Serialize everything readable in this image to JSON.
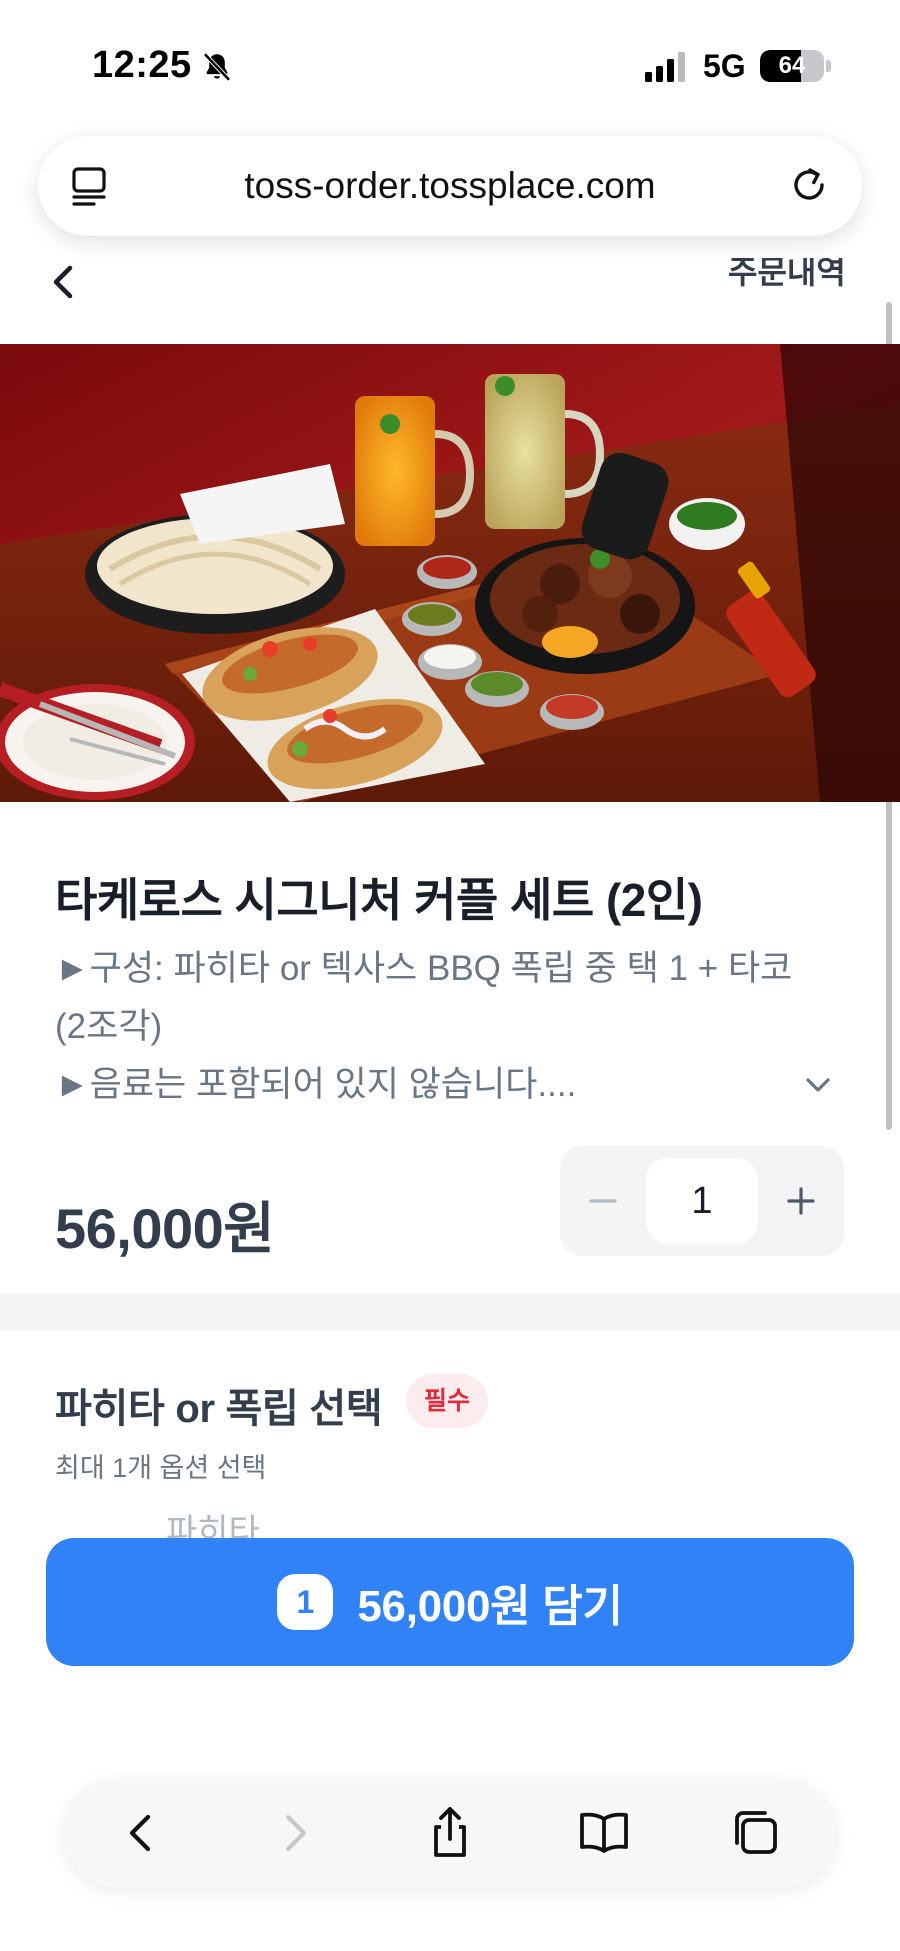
{
  "status_bar": {
    "time": "12:25",
    "network": "5G",
    "battery": "64",
    "battery_level": 0.64,
    "icons": [
      "bell-slash-icon",
      "cellular-signal-icon",
      "battery-icon"
    ]
  },
  "browser": {
    "url": "toss-order.tossplace.com",
    "icons": [
      "reader-icon",
      "reload-icon"
    ]
  },
  "header": {
    "back_icon": "chevron-left-icon",
    "order_history": "주문내역"
  },
  "product": {
    "title": "타케로스 시그니처 커플 세트 (2인)",
    "desc_line1": "►구성: 파히타 or 텍사스 BBQ 폭립 중 택 1 + 타코",
    "desc_line2": "(2조각)",
    "desc_line3": "►음료는 포함되어 있지 않습니다....",
    "price": "56,000원",
    "quantity": "1"
  },
  "option_group": {
    "title": "파히타 or 폭립 선택",
    "badge": "필수",
    "subtitle": "최대 1개 옵션 선택",
    "first_option": "파히타"
  },
  "cta": {
    "count": "1",
    "label": "56,000원 담기",
    "color": "#3182f6"
  },
  "toolbar": {
    "icons": [
      "back-icon",
      "forward-icon",
      "share-icon",
      "bookmarks-icon",
      "tabs-icon"
    ]
  }
}
